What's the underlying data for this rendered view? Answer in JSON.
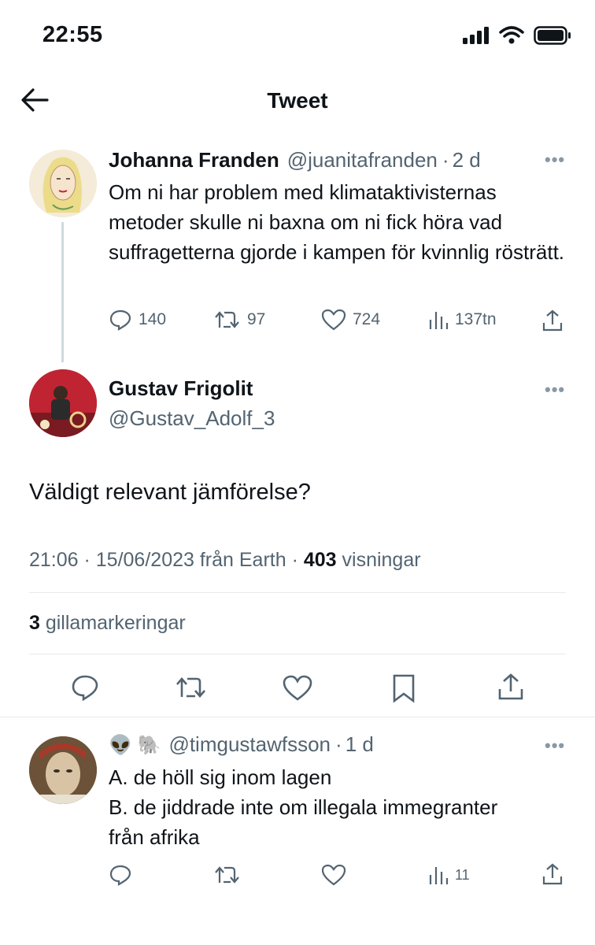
{
  "status_bar": {
    "time": "22:55"
  },
  "header": {
    "title": "Tweet"
  },
  "parent_tweet": {
    "name": "Johanna Franden",
    "handle": "@juanitafranden",
    "time": "2 d",
    "text": "Om ni har problem med klimataktivisternas metoder skulle ni baxna om ni fick höra vad suffragetterna gjorde i kampen för kvinnlig rösträtt.",
    "replies": "140",
    "retweets": "97",
    "likes": "724",
    "views": "137tn"
  },
  "main_tweet": {
    "name": "Gustav Frigolit",
    "handle": "@Gustav_Adolf_3",
    "text": "Väldigt relevant jämförelse?",
    "meta_time": "21:06 · 15/06/2023 från Earth · ",
    "views_count": "403",
    "views_label": " visningar",
    "likes_count": "3",
    "likes_label": " gillamarkeringar"
  },
  "reply_tweet": {
    "emoji": "👽 🐘",
    "handle": "@timgustawfsson",
    "time": "1 d",
    "line1": "A. de höll sig inom lagen",
    "line2": "B. de jiddrade inte om illegala immegranter",
    "line3": "från afrika",
    "views": "11"
  },
  "colors": {
    "text": "#0f1419",
    "secondary": "#536471",
    "divider": "#e7e9ea"
  },
  "icons": [
    "back-arrow-icon",
    "reply-icon",
    "retweet-icon",
    "like-icon",
    "views-icon",
    "share-icon",
    "bookmark-icon",
    "more-icon",
    "signal-icon",
    "wifi-icon",
    "battery-icon"
  ]
}
